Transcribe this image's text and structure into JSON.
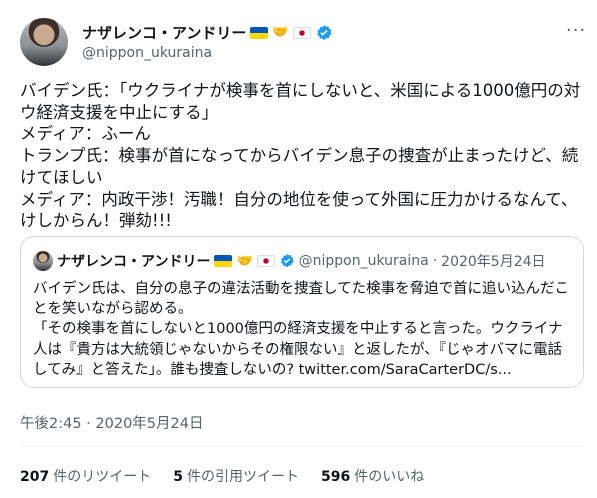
{
  "author": {
    "name": "ナザレンコ・アンドリー",
    "handle": "@nippon_ukuraina"
  },
  "tweet": {
    "lines": [
      "バイデン氏：「ウクライナが検事を首にしないと、米国による1000億円の対ウ経済支援を中止にする」",
      "メディア：ふーん",
      "トランプ氏：検事が首になってからバイデン息子の捜査が止まったけど、続けてほしい",
      "メディア：内政干渉！汚職！自分の地位を使って外国に圧力かけるなんて、けしからん！弾劾!!!"
    ]
  },
  "quote": {
    "name": "ナザレンコ・アンドリー",
    "handle": "@nippon_ukuraina",
    "separator": "·",
    "date": "2020年5月24日",
    "lines": [
      "バイデン氏は、自分の息子の違法活動を捜査してた検事を脅迫で首に追い込んだことを笑いながら認める。",
      "「その検事を首にしないと1000億円の経済支援を中止すると言った。ウクライナ人は『貴方は大統領じゃないからその権限ない』と返したが、『じゃオバマに電話してみ』と答えた」。誰も捜査しないの? twitter.com/SaraCarterDC/s..."
    ]
  },
  "timestamp": "午後2:45 · 2020年5月24日",
  "stats": {
    "retweets_count": "207",
    "retweets_label": "件のリツイート",
    "quotes_count": "5",
    "quotes_label": "件の引用ツイート",
    "likes_count": "596",
    "likes_label": "件のいいね"
  },
  "icons": {
    "more": "more-horizontal-icon",
    "verified": "verified-badge-icon",
    "flag1": "ukraine-flag-icon",
    "hands": "handshake-icon",
    "flag2": "japan-flag-icon"
  },
  "colors": {
    "text": "#0f1419",
    "secondary": "#536471",
    "verified": "#1d9bf0",
    "border": "#cfd9de"
  }
}
